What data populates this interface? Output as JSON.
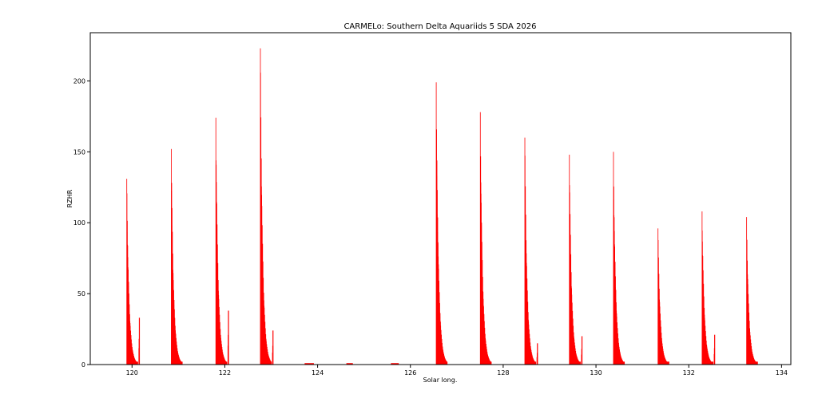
{
  "chart_data": {
    "type": "bar",
    "title": "CARMELo: Southern Delta Aquariids 5 SDA 2026",
    "xlabel": "Solar long.",
    "ylabel": "RZHR",
    "xlim": [
      119.1,
      134.2
    ],
    "ylim": [
      0,
      234
    ],
    "xticks": [
      120,
      122,
      124,
      126,
      128,
      130,
      132,
      134
    ],
    "yticks": [
      0,
      50,
      100,
      150,
      200
    ],
    "grid": false,
    "bar_color": "#ff0000",
    "bursts": [
      {
        "start": 119.88,
        "peak": 131,
        "stub": 33
      },
      {
        "start": 120.84,
        "peak": 152,
        "stub": 0
      },
      {
        "start": 121.8,
        "peak": 174,
        "stub": 38
      },
      {
        "start": 122.76,
        "peak": 223,
        "stub": 24
      },
      {
        "start": 126.55,
        "peak": 199,
        "stub": 0
      },
      {
        "start": 127.5,
        "peak": 178,
        "stub": 0
      },
      {
        "start": 128.46,
        "peak": 160,
        "stub": 15
      },
      {
        "start": 129.42,
        "peak": 148,
        "stub": 20
      },
      {
        "start": 130.37,
        "peak": 150,
        "stub": 0
      },
      {
        "start": 131.33,
        "peak": 96,
        "stub": 0
      },
      {
        "start": 132.28,
        "peak": 108,
        "stub": 21
      },
      {
        "start": 133.24,
        "peak": 104,
        "stub": 0
      }
    ],
    "low_segments": [
      {
        "x0": 123.72,
        "x1": 123.92,
        "value": 1
      },
      {
        "x0": 124.62,
        "x1": 124.76,
        "value": 1
      },
      {
        "x0": 125.58,
        "x1": 125.75,
        "value": 1
      }
    ]
  }
}
